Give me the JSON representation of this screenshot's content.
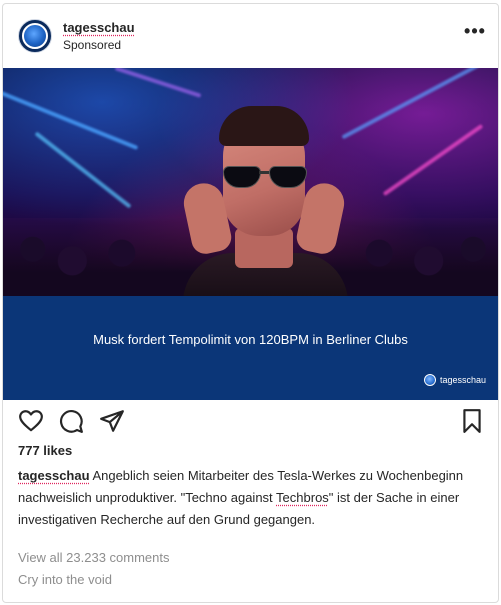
{
  "post": {
    "username": "tagesschau",
    "sponsored_label": "Sponsored",
    "more_icon": "more-horizontal-icon",
    "image": {
      "headline": "Musk fordert Tempolimit von 120BPM in Berliner Clubs",
      "brand_text": "tagesschau",
      "banner_color": "#0b3678"
    },
    "actions": {
      "like_icon": "heart-icon",
      "comment_icon": "comment-icon",
      "share_icon": "share-icon",
      "save_icon": "bookmark-icon"
    },
    "likes": "777 likes",
    "caption": {
      "username": "tagesschau",
      "text_part1": " Angeblich seien Mitarbeiter des Tesla-Werkes zu Wochenbeginn nachweislich unproduktiver. \"Techno against ",
      "highlight": "Techbros",
      "text_part2": "\" ist der Sache in einer investigativen Recherche auf den Grund gegangen."
    },
    "view_comments": "View all 23.233 comments",
    "add_comment": "Cry into the void"
  }
}
